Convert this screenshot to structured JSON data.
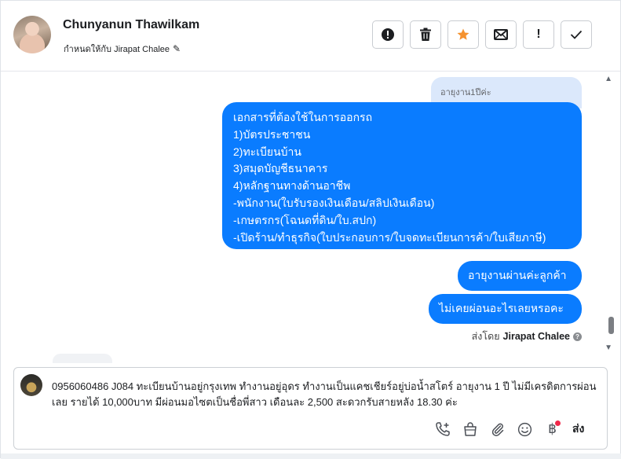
{
  "header": {
    "contact_name": "Chunyanun Thawilkam",
    "assigned_to": "กำหนดให้กับ Jirapat Chalee",
    "pencil_icon": "✎",
    "toolbar": {
      "spam_icon": "❗",
      "delete_icon": "🗑",
      "star_icon": "★",
      "mail_icon": "✉",
      "important_icon": "!",
      "done_icon": "✓"
    }
  },
  "chat": {
    "quoted_text": "อายุงาน1ปีค่ะ",
    "messages": {
      "documents": [
        "เอกสารที่ต้องใช้ในการออกรถ",
        "1)บัตรประชาชน",
        "2)ทะเบียนบ้าน",
        "3)สมุดบัญชีธนาคาร",
        "4)หลักฐานทางด้านอาชีพ",
        "-พนักงาน(ใบรับรองเงินเดือน/สลิปเงินเดือน)",
        "-เกษตรกร(โฉนดที่ดิน/ใบ.สปก)",
        "-เปิดร้าน/ทำธุรกิจ(ใบประกอบการ/ใบจดทะเบียนการค้า/ใบเสียภาษี)"
      ],
      "work_age": "อายุงานผ่านค่ะลูกค้า",
      "never_paid": "ไม่เคยผ่อนอะไรเลยหรอคะ"
    },
    "sent_by_label": "ส่งโดย",
    "sent_by_name": "Jirapat Chalee",
    "help_icon": "?",
    "scroll_up_icon": "▲",
    "scroll_down_icon": "▼"
  },
  "composer": {
    "text": "0956060486 J084 ทะเบียนบ้านอยู่กรุงเทพ ทำงานอยู่อุดร ทำงานเป็นแคชเชียร์อยู่บ่อน้ำสโตร์ อายุงาน 1 ปี ไม่มีเครดิตการผ่อนเลย รายได้ 10,000บาท มีผ่อนมอไซตเป็นชื่อพี่สาว เดือนละ 2,500 สะดวกรับสายหลัง 18.30 ค่ะ",
    "tools": {
      "call_icon": "✆",
      "bag_icon": "🛍",
      "attach_icon": "📎",
      "emoji_icon": "☺",
      "baht_icon": "฿"
    },
    "send_label": "ส่ง"
  },
  "colors": {
    "bubble": "#0a7cff",
    "quote": "#dbe8fb",
    "star": "#f5922f",
    "badge": "#f02849"
  }
}
